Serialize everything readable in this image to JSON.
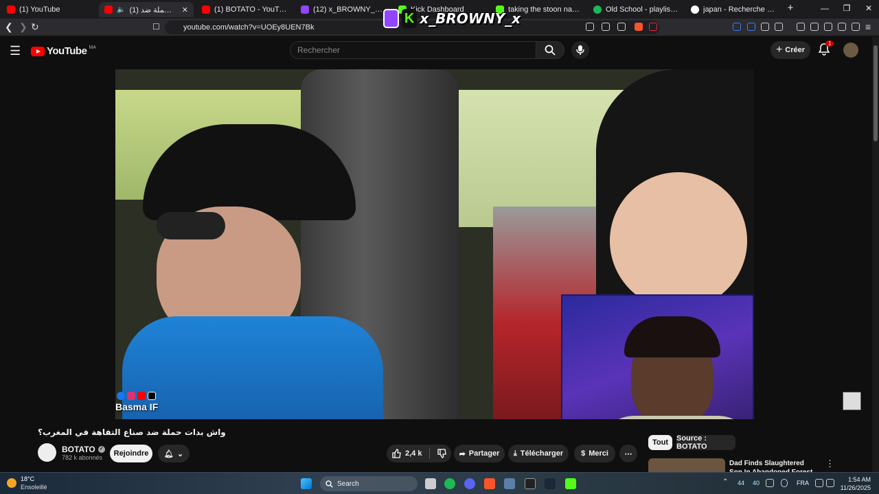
{
  "browser": {
    "tabs": [
      {
        "label": "(1) YouTube",
        "icon": "youtube-icon",
        "color": "#ff0000"
      },
      {
        "label": "(1) واش بدات حملة ضد",
        "icon": "youtube-icon",
        "color": "#ff0000",
        "active": true
      },
      {
        "label": "(1) BOTATO - YouTube",
        "icon": "youtube-icon",
        "color": "#ff0000"
      },
      {
        "label": "(12) x_BROWNY_x - Twitch",
        "icon": "twitch-icon",
        "color": "#9146ff"
      },
      {
        "label": "Kick Dashboard",
        "icon": "kick-icon",
        "color": "#53fc18"
      },
      {
        "label": "taking the stoon namsaaayn",
        "icon": "kick-icon",
        "color": "#53fc18"
      },
      {
        "label": "Old School - playlist by YSF | S",
        "icon": "spotify-icon",
        "color": "#1db954"
      },
      {
        "label": "japan - Recherche Google",
        "icon": "google-icon",
        "color": "#4285f4"
      }
    ],
    "url": "youtube.com/watch?v=UOEy8UEN7Bk"
  },
  "stream_overlay": {
    "name": "x_BROWNY_x"
  },
  "youtube": {
    "logo": "YouTube",
    "region": "MA",
    "search_placeholder": "Rechercher",
    "create_label": "Créer",
    "notif_count": "1",
    "video_title": "واش بدات حملة ضد صناع التفاهة في المغرب؟",
    "watermark": "Basma IF",
    "channel": {
      "name": "BOTATO",
      "subscribers": "782 k abonnés"
    },
    "join_label": "Rejoindre",
    "likes": "2,4 k",
    "share_label": "Partager",
    "download_label": "Télécharger",
    "thanks_label": "Merci",
    "chips": [
      "Tout",
      "Source : BOTATO"
    ],
    "reco_title": "Dad Finds Slaughtered Son In Abandoned Forest"
  },
  "taskbar": {
    "weather_temp": "18°C",
    "weather_desc": "Ensoleillé",
    "search_label": "Search",
    "tray_a": "44",
    "tray_b": "40",
    "lang": "FRA",
    "time": "1:54 AM",
    "date": "11/26/2025"
  }
}
